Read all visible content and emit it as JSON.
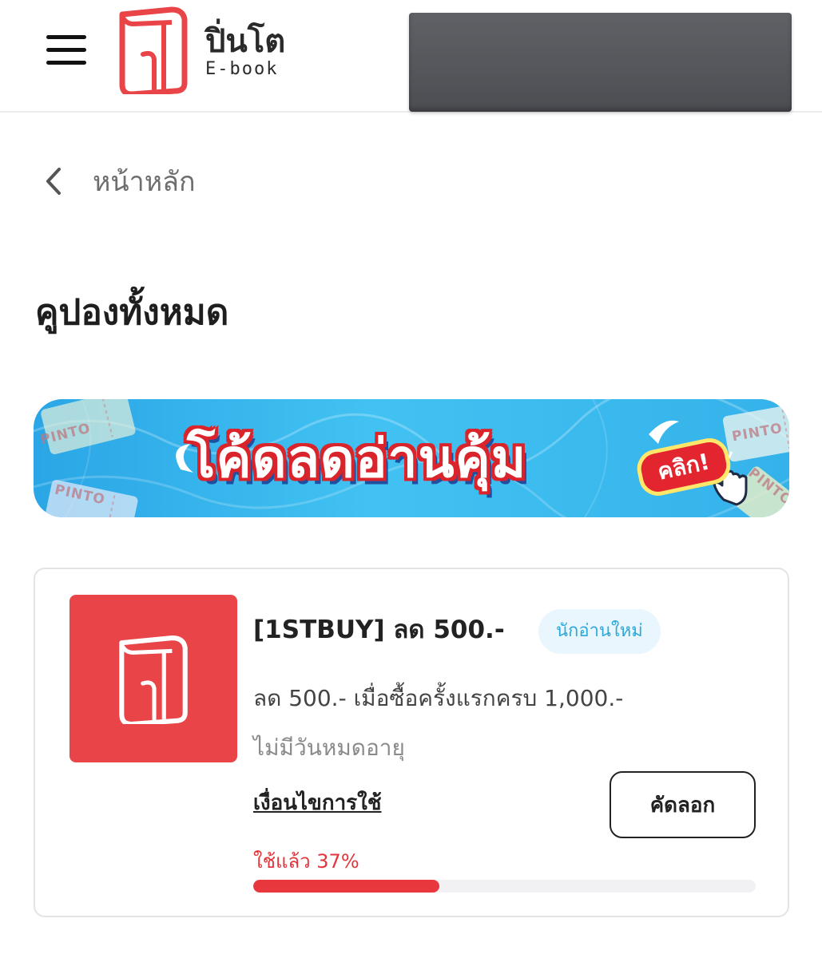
{
  "header": {
    "logo_th": "ปิ่นโต",
    "logo_en": "E-book"
  },
  "breadcrumb": {
    "back_label": "หน้าหลัก"
  },
  "page": {
    "title": "คูปองทั้งหมด"
  },
  "banner": {
    "headline": "โค้ดลดอ่านคุ้ม",
    "click_label": "คลิก!",
    "ticket_text": "PINTO"
  },
  "coupon": {
    "code_title": "[1STBUY] ลด 500.-",
    "badge": "นักอ่านใหม่",
    "description": "ลด 500.- เมื่อซื้อครั้งแรกครบ 1,000.-",
    "expiry": "ไม่มีวันหมดอายุ",
    "conditions_link": "เงื่อนไขการใช้",
    "copy_button": "คัดลอก",
    "usage_label": "ใช้แล้ว 37%",
    "usage_percent": 37
  },
  "icons": {
    "menu": "hamburger-menu-icon",
    "logo": "book-logo-icon",
    "back": "chevron-left-icon",
    "pointer": "hand-pointer-icon"
  },
  "colors": {
    "brand_red": "#e94548",
    "badge_text": "#2ea8d9",
    "badge_bg": "#e9f6fd",
    "usage_text": "#e0363c",
    "banner_blue": "#42c2f2"
  }
}
